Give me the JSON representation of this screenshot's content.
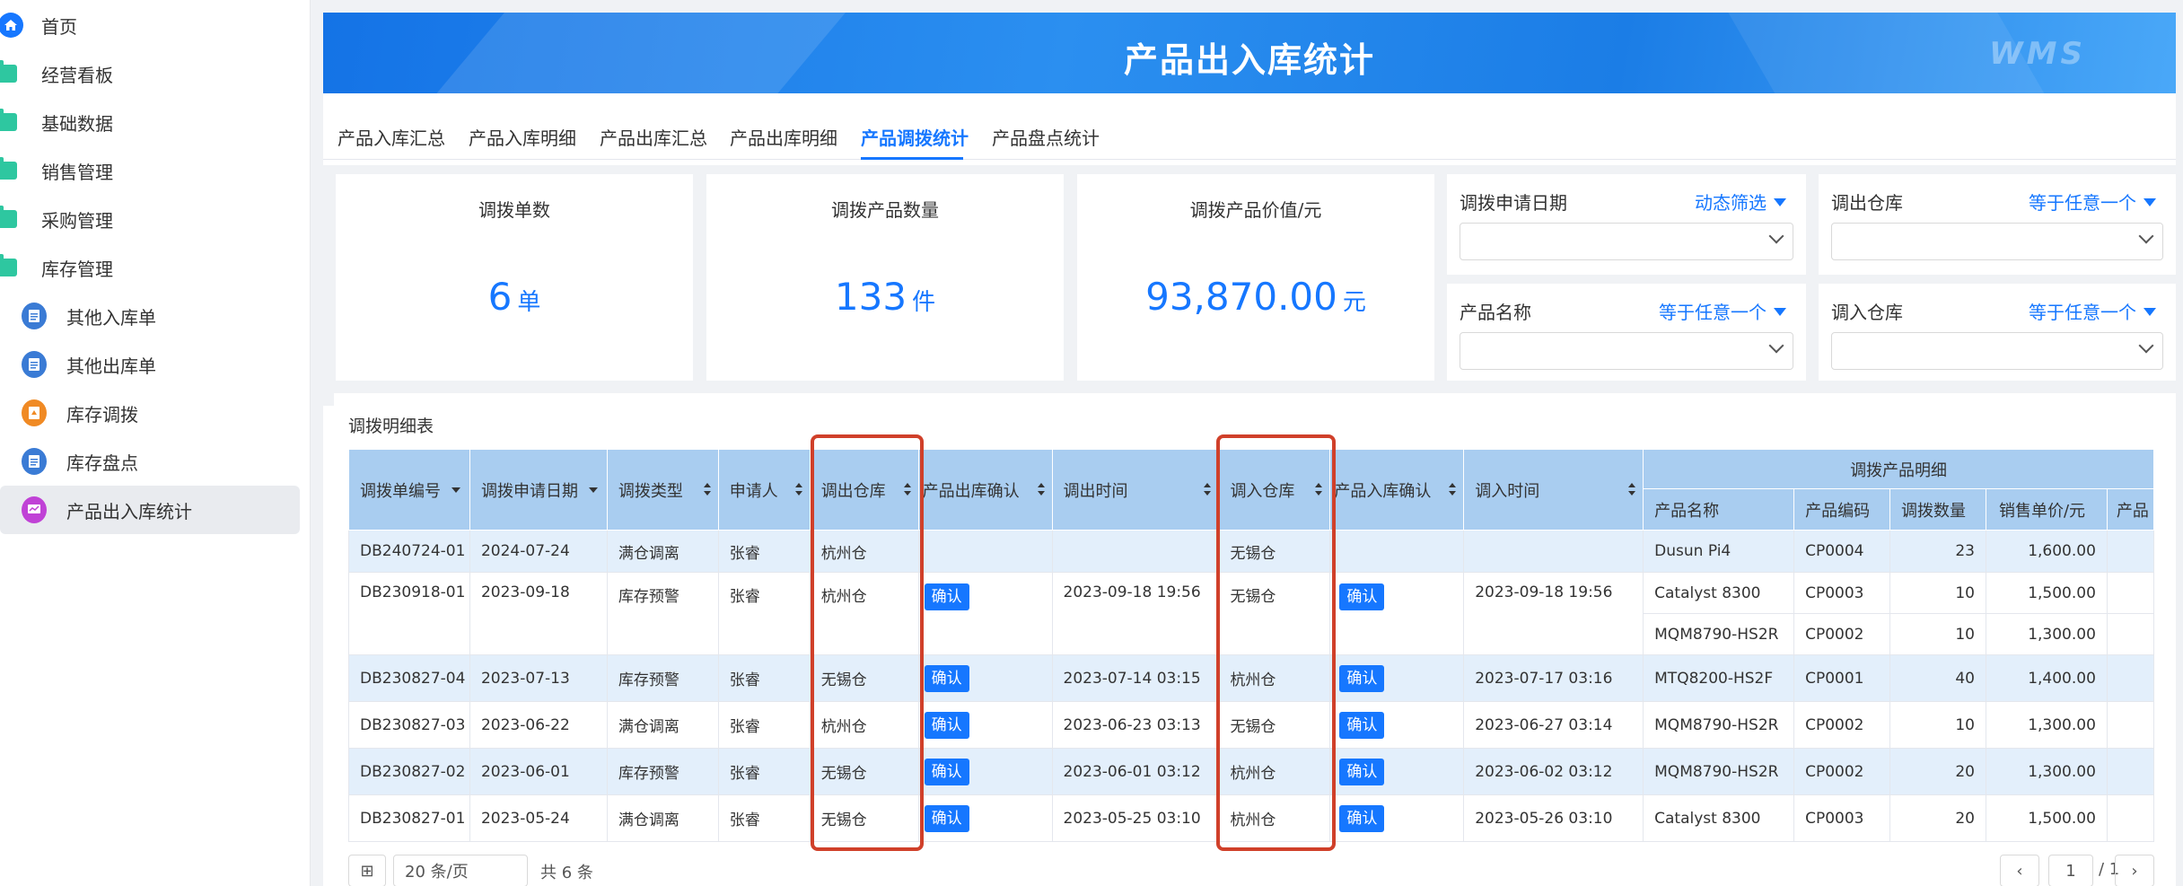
{
  "sidebar": {
    "items": [
      {
        "label": "首页",
        "icon": "home-icon"
      },
      {
        "label": "经营看板",
        "icon": "folder-icon"
      },
      {
        "label": "基础数据",
        "icon": "folder-icon"
      },
      {
        "label": "销售管理",
        "icon": "folder-icon"
      },
      {
        "label": "采购管理",
        "icon": "folder-icon"
      },
      {
        "label": "库存管理",
        "icon": "folder-icon"
      },
      {
        "label": "其他入库单",
        "icon": "document-icon"
      },
      {
        "label": "其他出库单",
        "icon": "document-icon"
      },
      {
        "label": "库存调拨",
        "icon": "transfer-icon"
      },
      {
        "label": "库存盘点",
        "icon": "document-icon"
      },
      {
        "label": "产品出入库统计",
        "icon": "report-icon",
        "active": true
      }
    ]
  },
  "banner": {
    "title": "产品出入库统计",
    "logo": "WMS"
  },
  "tabs": [
    {
      "label": "产品入库汇总"
    },
    {
      "label": "产品入库明细"
    },
    {
      "label": "产品出库汇总"
    },
    {
      "label": "产品出库明细"
    },
    {
      "label": "产品调拨统计",
      "active": true
    },
    {
      "label": "产品盘点统计"
    }
  ],
  "stats": [
    {
      "title": "调拨单数",
      "value": "6",
      "unit": "单"
    },
    {
      "title": "调拨产品数量",
      "value": "133",
      "unit": "件"
    },
    {
      "title": "调拨产品价值/元",
      "value": "93,870.00",
      "unit": "元"
    }
  ],
  "filters": [
    {
      "label": "调拨申请日期",
      "op": "动态筛选",
      "value": ""
    },
    {
      "label": "调出仓库",
      "op": "等于任意一个",
      "value": ""
    },
    {
      "label": "产品名称",
      "op": "等于任意一个",
      "value": ""
    },
    {
      "label": "调入仓库",
      "op": "等于任意一个",
      "value": ""
    }
  ],
  "table": {
    "caption": "调拨明细表",
    "headers": [
      "调拨单编号",
      "调拨申请日期",
      "调拨类型",
      "申请人",
      "调出仓库",
      "产品出库确认",
      "调出时间",
      "调入仓库",
      "产品入库确认",
      "调入时间"
    ],
    "group_header": "调拨产品明细",
    "sub_headers": [
      "产品名称",
      "产品编码",
      "调拨数量",
      "销售单价/元",
      "产品"
    ],
    "confirm_label": "确认",
    "rows": [
      {
        "id": "DB240724-01",
        "date": "2024-07-24",
        "type": "满仓调离",
        "applicant": "张睿",
        "out_wh": "杭州仓",
        "out_confirm": false,
        "out_time": "",
        "in_wh": "无锡仓",
        "in_confirm": false,
        "in_time": "",
        "products": [
          {
            "name": "Dusun Pi4",
            "code": "CP0004",
            "qty": "23",
            "price": "1,600.00"
          }
        ]
      },
      {
        "id": "DB230918-01",
        "date": "2023-09-18",
        "type": "库存预警",
        "applicant": "张睿",
        "out_wh": "杭州仓",
        "out_confirm": true,
        "out_time": "2023-09-18 19:56",
        "in_wh": "无锡仓",
        "in_confirm": true,
        "in_time": "2023-09-18 19:56",
        "products": [
          {
            "name": "Catalyst 8300",
            "code": "CP0003",
            "qty": "10",
            "price": "1,500.00"
          },
          {
            "name": "MQM8790-HS2R",
            "code": "CP0002",
            "qty": "10",
            "price": "1,300.00"
          }
        ]
      },
      {
        "id": "DB230827-04",
        "date": "2023-07-13",
        "type": "库存预警",
        "applicant": "张睿",
        "out_wh": "无锡仓",
        "out_confirm": true,
        "out_time": "2023-07-14 03:15",
        "in_wh": "杭州仓",
        "in_confirm": true,
        "in_time": "2023-07-17 03:16",
        "products": [
          {
            "name": "MTQ8200-HS2F",
            "code": "CP0001",
            "qty": "40",
            "price": "1,400.00"
          }
        ]
      },
      {
        "id": "DB230827-03",
        "date": "2023-06-22",
        "type": "满仓调离",
        "applicant": "张睿",
        "out_wh": "杭州仓",
        "out_confirm": true,
        "out_time": "2023-06-23 03:13",
        "in_wh": "无锡仓",
        "in_confirm": true,
        "in_time": "2023-06-27 03:14",
        "products": [
          {
            "name": "MQM8790-HS2R",
            "code": "CP0002",
            "qty": "10",
            "price": "1,300.00"
          }
        ]
      },
      {
        "id": "DB230827-02",
        "date": "2023-06-01",
        "type": "库存预警",
        "applicant": "张睿",
        "out_wh": "无锡仓",
        "out_confirm": true,
        "out_time": "2023-06-01 03:12",
        "in_wh": "杭州仓",
        "in_confirm": true,
        "in_time": "2023-06-02 03:12",
        "products": [
          {
            "name": "MQM8790-HS2R",
            "code": "CP0002",
            "qty": "20",
            "price": "1,300.00"
          }
        ]
      },
      {
        "id": "DB230827-01",
        "date": "2023-05-24",
        "type": "满仓调离",
        "applicant": "张睿",
        "out_wh": "无锡仓",
        "out_confirm": true,
        "out_time": "2023-05-25 03:10",
        "in_wh": "杭州仓",
        "in_confirm": true,
        "in_time": "2023-05-26 03:10",
        "products": [
          {
            "name": "Catalyst 8300",
            "code": "CP0003",
            "qty": "20",
            "price": "1,500.00"
          }
        ]
      }
    ]
  },
  "pager": {
    "page_size": "20 条/页",
    "total": "共 6 条",
    "current_page": "1",
    "total_pages": "/ 1"
  },
  "colors": {
    "accent": "#1677ff",
    "highlight": "#d0402a",
    "header_bg": "#a9cdf0",
    "row_alt": "#e3effb"
  }
}
